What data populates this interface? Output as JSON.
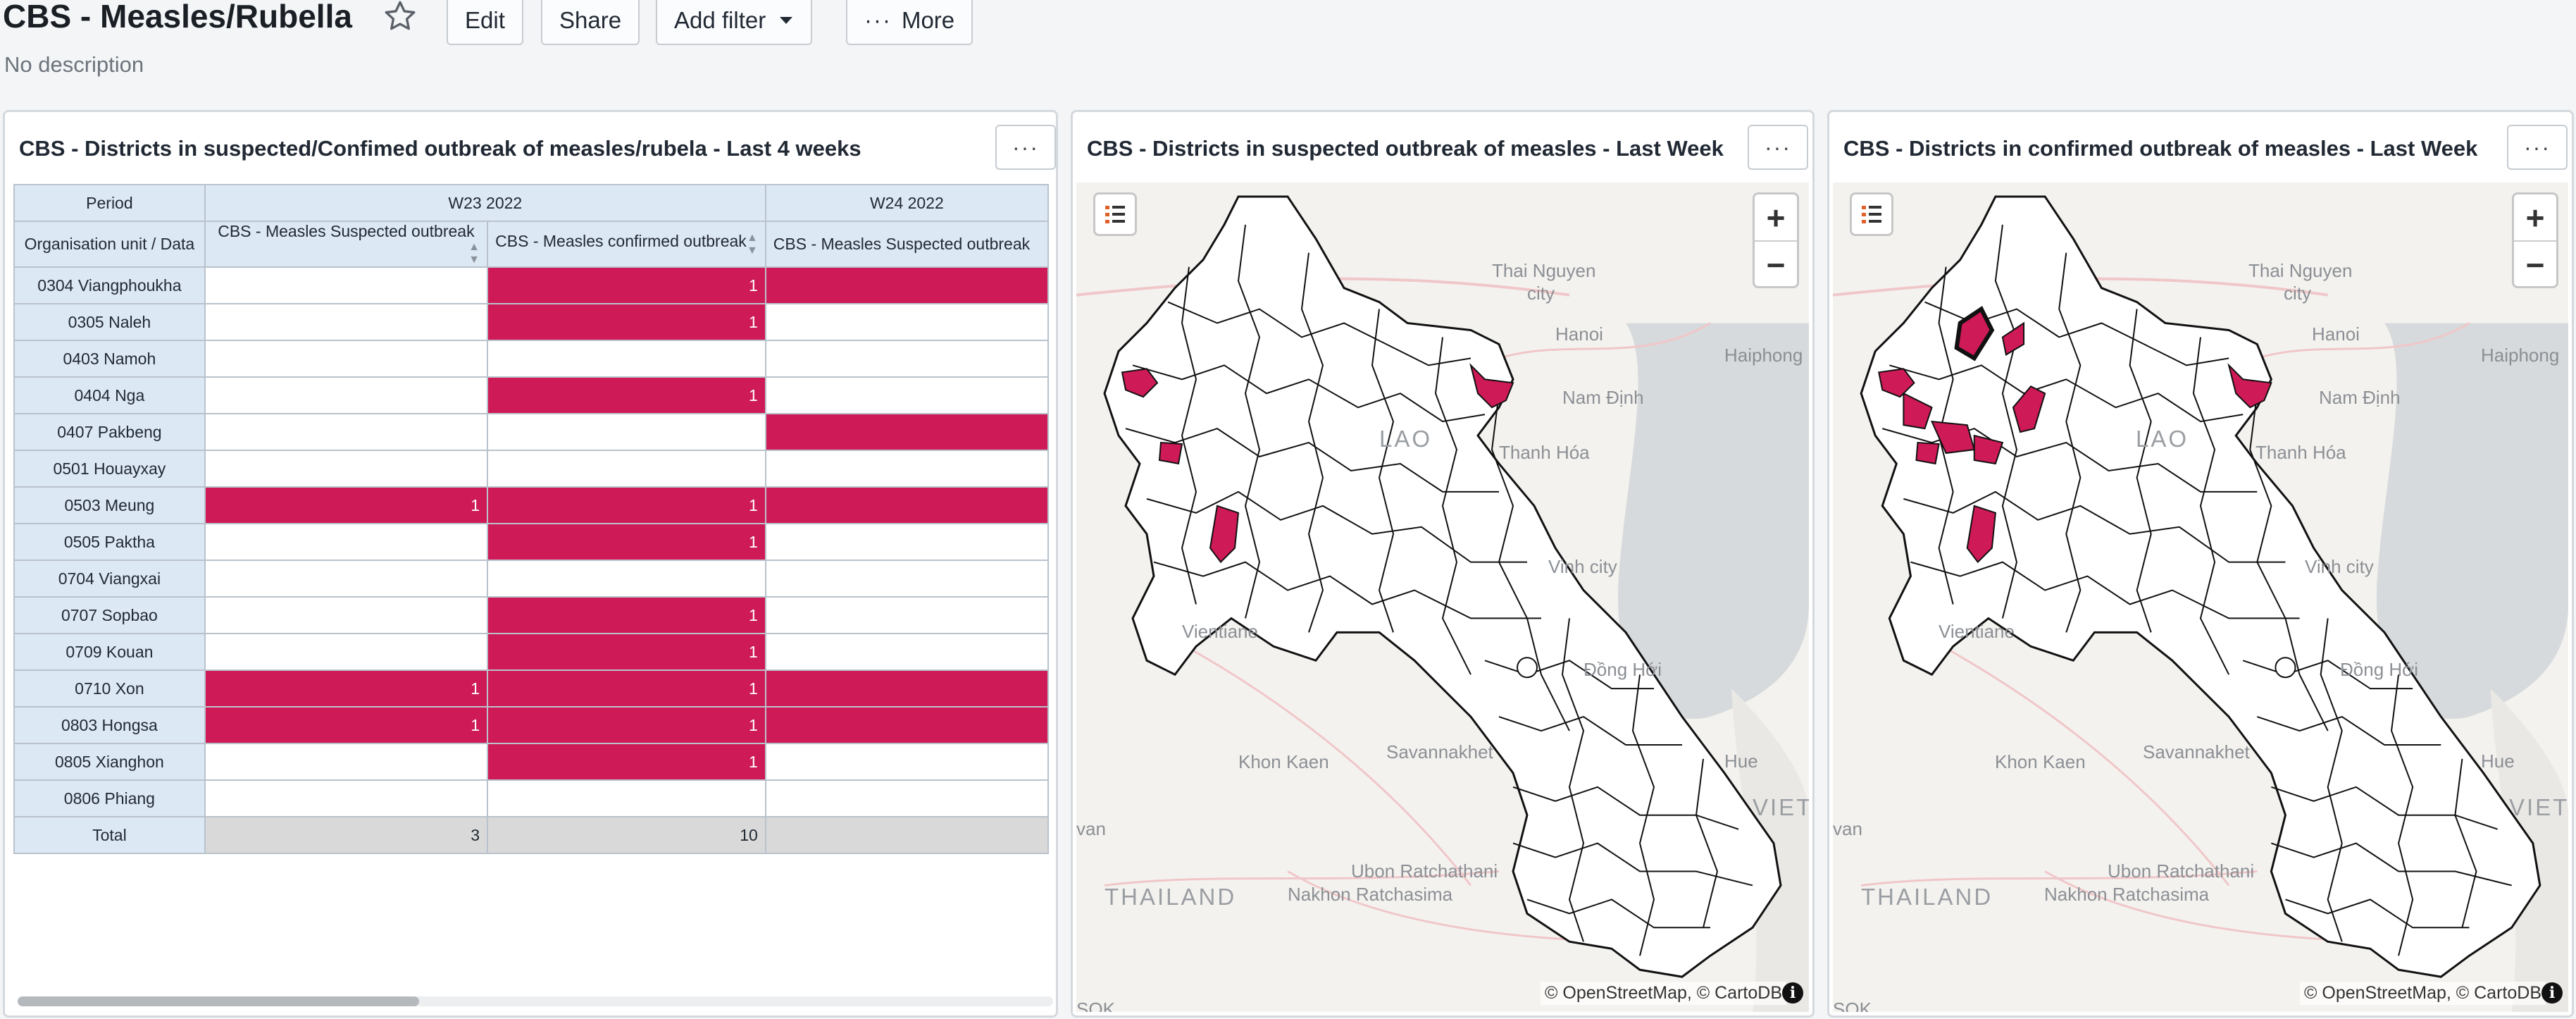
{
  "dashboard": {
    "title": "CBS - Measles/Rubella",
    "description": "No description",
    "buttons": {
      "edit": "Edit",
      "share": "Share",
      "add_filter": "Add filter",
      "more": "More"
    }
  },
  "colors": {
    "outbreak": "#ce1a56",
    "header_bg": "#dde8f5",
    "total_bg": "#d9d9d9"
  },
  "table_card": {
    "title": "CBS - Districts in suspected/Confimed outbreak of measles/rubela - Last 4 weeks",
    "menu": "···",
    "period_header": "Period",
    "ou_header": "Organisation unit / Data",
    "periods": [
      "W23 2022",
      "W24 2022"
    ],
    "columns": [
      "CBS - Measles Suspected outbreak",
      "CBS - Measles confirmed outbreak",
      "CBS - Measles Suspected outbreak"
    ],
    "rows": [
      {
        "name": "0304 Viangphoukha",
        "c1": "",
        "c2": "1",
        "c3": ""
      },
      {
        "name": "0305 Naleh",
        "c1": "",
        "c2": "1",
        "c3": ""
      },
      {
        "name": "0403 Namoh",
        "c1": "",
        "c2": "",
        "c3": ""
      },
      {
        "name": "0404 Nga",
        "c1": "",
        "c2": "1",
        "c3": ""
      },
      {
        "name": "0407 Pakbeng",
        "c1": "",
        "c2": "",
        "c3": ""
      },
      {
        "name": "0501 Houayxay",
        "c1": "",
        "c2": "",
        "c3": ""
      },
      {
        "name": "0503 Meung",
        "c1": "1",
        "c2": "1",
        "c3": ""
      },
      {
        "name": "0505 Paktha",
        "c1": "",
        "c2": "1",
        "c3": ""
      },
      {
        "name": "0704 Viangxai",
        "c1": "",
        "c2": "",
        "c3": ""
      },
      {
        "name": "0707 Sopbao",
        "c1": "",
        "c2": "1",
        "c3": ""
      },
      {
        "name": "0709 Kouan",
        "c1": "",
        "c2": "1",
        "c3": ""
      },
      {
        "name": "0710 Xon",
        "c1": "1",
        "c2": "1",
        "c3": ""
      },
      {
        "name": "0803 Hongsa",
        "c1": "1",
        "c2": "1",
        "c3": ""
      },
      {
        "name": "0805 Xianghon",
        "c1": "",
        "c2": "1",
        "c3": ""
      },
      {
        "name": "0806 Phiang",
        "c1": "",
        "c2": "",
        "c3": ""
      }
    ],
    "highlight_c3": [
      true,
      false,
      false,
      false,
      true,
      false,
      true,
      false,
      false,
      false,
      false,
      true,
      true,
      false,
      false
    ],
    "total_label": "Total",
    "total": {
      "c1": "3",
      "c2": "10",
      "c3": ""
    }
  },
  "map_suspected": {
    "title": "CBS - Districts in suspected outbreak of measles - Last Week",
    "menu": "···",
    "zoom_in": "+",
    "zoom_out": "−",
    "attribution": "© OpenStreetMap, © CartoDB",
    "info": "i",
    "labels": {
      "thai_nguyen": "Thai Nguyen",
      "city1": "city",
      "hanoi": "Hanoi",
      "haiphong": "Haiphong",
      "nam_dinh": "Nam Định",
      "thanh_hoa": "Thanh Hóa",
      "vinh": "Vinh city",
      "dong_hoi": "Đồng Hới",
      "vientiane": "Vientiane",
      "khon_kaen": "Khon Kaen",
      "savannakhet": "Savannakhet",
      "hue": "Hue",
      "viet": "VIET",
      "ubon": "Ubon Ratchathani",
      "nakhon": "Nakhon Ratchasima",
      "thailand": "THAILAND",
      "lao": "LAO",
      "van": "van",
      "sok": "SOK"
    }
  },
  "map_confirmed": {
    "title": "CBS - Districts in confirmed outbreak of measles - Last Week",
    "menu": "···",
    "zoom_in": "+",
    "zoom_out": "−",
    "attribution": "© OpenStreetMap, © CartoDB",
    "info": "i",
    "labels": {
      "thai_nguyen": "Thai Nguyen",
      "city1": "city",
      "hanoi": "Hanoi",
      "haiphong": "Haiphong",
      "nam_dinh": "Nam Định",
      "thanh_hoa": "Thanh Hóa",
      "vinh": "Vinh city",
      "dong_hoi": "Đồng Hới",
      "vientiane": "Vientiane",
      "khon_kaen": "Khon Kaen",
      "savannakhet": "Savannakhet",
      "hue": "Hue",
      "viet": "VIET",
      "ubon": "Ubon Ratchathani",
      "nakhon": "Nakhon Ratchasima",
      "thailand": "THAILAND",
      "lao": "LAO",
      "van": "van",
      "sok": "SOK"
    }
  }
}
